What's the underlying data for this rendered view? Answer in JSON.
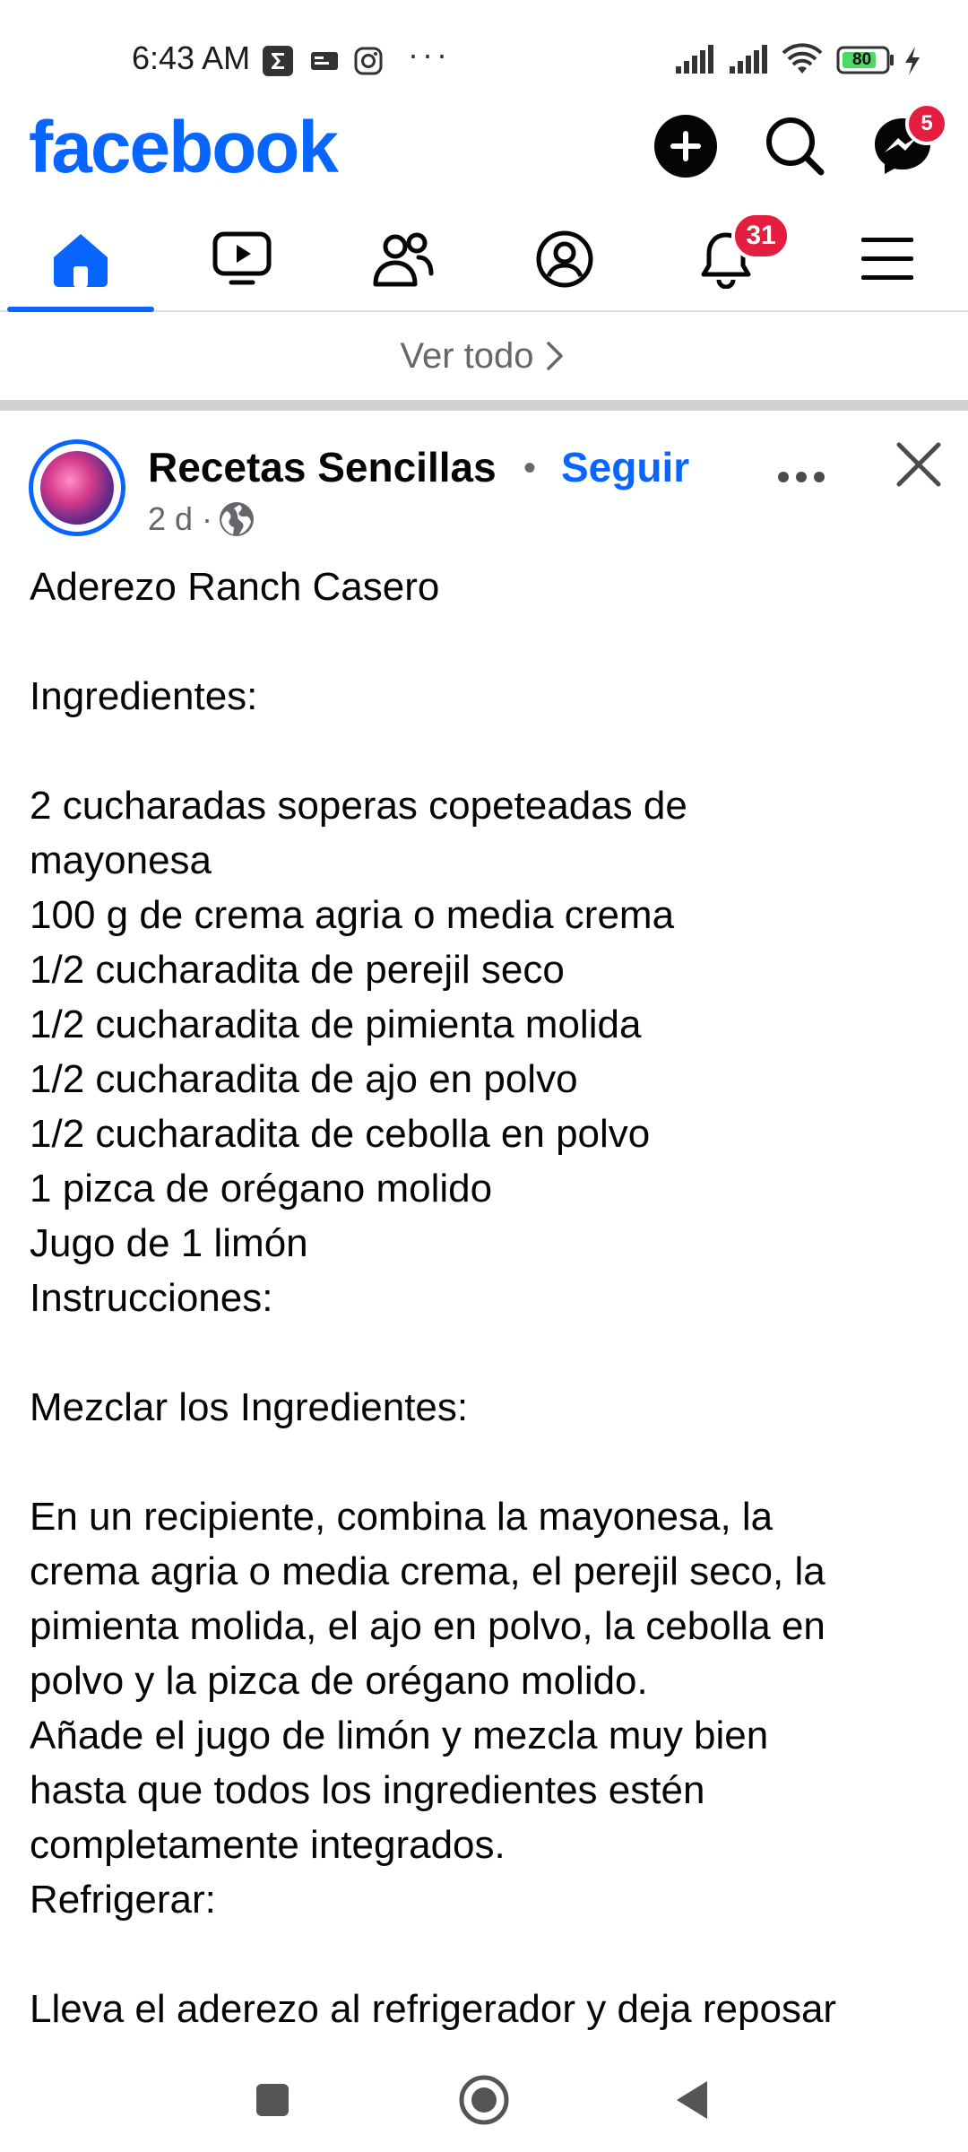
{
  "status_bar": {
    "time": "6:43 AM",
    "more_indicator": "···",
    "battery_level": "80",
    "icons": [
      "sigma-app-icon",
      "card-app-icon",
      "instagram-icon",
      "signal-icon",
      "signal-icon",
      "wifi-icon",
      "battery-icon",
      "charging-icon"
    ]
  },
  "header": {
    "brand": "facebook",
    "messenger_badge": "5"
  },
  "tabs": [
    {
      "name": "home",
      "active": true
    },
    {
      "name": "video"
    },
    {
      "name": "friends"
    },
    {
      "name": "profile"
    },
    {
      "name": "notifications",
      "badge": "31"
    },
    {
      "name": "menu"
    }
  ],
  "see_all": "Ver todo",
  "post": {
    "page_name": "Recetas Sencillas",
    "separator": "•",
    "follow": "Seguir",
    "time": "2 d ·",
    "lines": [
      "Aderezo Ranch Casero",
      "",
      "Ingredientes:",
      "",
      "2 cucharadas soperas copeteadas de",
      "mayonesa",
      "100 g de crema agria o media crema",
      "1/2 cucharadita de perejil seco",
      "1/2 cucharadita de pimienta molida",
      "1/2 cucharadita de ajo en polvo",
      "1/2 cucharadita de cebolla en polvo",
      "1 pizca de orégano molido",
      "Jugo de 1 limón",
      "Instrucciones:",
      "",
      "Mezclar los Ingredientes:",
      "",
      "En un recipiente, combina la mayonesa, la",
      "crema agria o media crema, el perejil seco, la",
      "pimienta molida, el ajo en polvo, la cebolla en",
      "polvo y la pizca de orégano molido.",
      "Añade el jugo de limón y mezcla muy bien",
      "hasta que todos los ingredientes estén",
      "completamente integrados.",
      "Refrigerar:",
      "",
      "Lleva el aderezo al refrigerador y deja reposar"
    ]
  },
  "colors": {
    "brand": "#0866ff",
    "badge": "#e41e3f",
    "secondary_text": "#65676b",
    "divider": "#ced0d4"
  }
}
